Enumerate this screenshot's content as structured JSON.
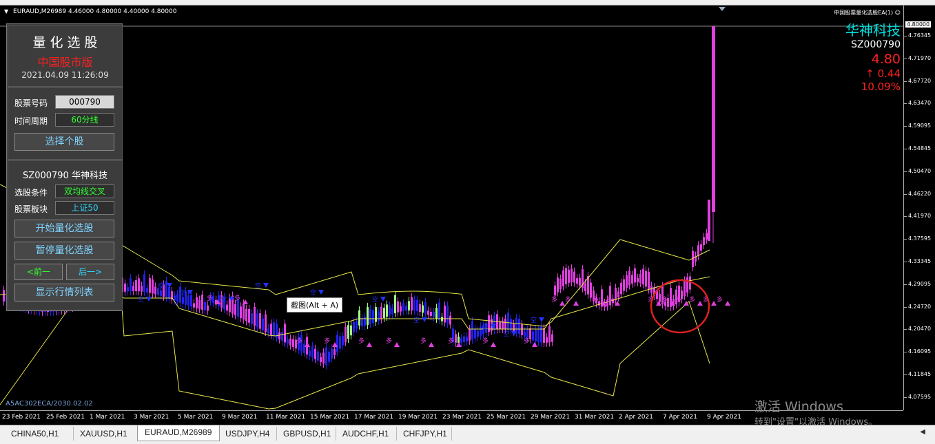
{
  "header": {
    "symbol_info": "EURAUD,M26989  4.46000 4.80000 4.40000 4.80000",
    "ea_name": "中国股票量化选股EA(1)"
  },
  "stock_info": {
    "name": "华神科技",
    "code": "SZ000790",
    "price": "4.80",
    "change": "↑ 0.44",
    "change_pct": "10.09%"
  },
  "panel": {
    "title": "量 化 选 股",
    "subtitle": "中国股市版",
    "datetime": "2021.04.09 11:26:09",
    "stock_code_label": "股票号码",
    "stock_code_value": "000790",
    "period_label": "时间周期",
    "period_value": "60分线",
    "select_stock_button": "选择个股",
    "current_stock": "SZ000790 华神科技",
    "condition_label": "选股条件",
    "condition_value": "双均线交叉",
    "sector_label": "股票板块",
    "sector_value": "上证50",
    "start_button": "开始量化选股",
    "pause_button": "暂停量化选股",
    "prev_button": "<前一",
    "next_button": "后一>",
    "show_list_button": "显示行情列表"
  },
  "tooltip": "截图(Alt + A)",
  "build_label": "A5AC302ECA/2030.02.02",
  "watermark": {
    "line1": "激活 Windows",
    "line2": "转到\"设置\"以激活 Windows。"
  },
  "price_axis": {
    "current": "4.80000",
    "ticks": [
      "4.76345",
      "4.71970",
      "4.67720",
      "4.63470",
      "4.59095",
      "4.54845",
      "4.50470",
      "4.46220",
      "4.41970",
      "4.37595",
      "4.33345",
      "4.29095",
      "4.24720",
      "4.20470",
      "4.16095",
      "4.11845",
      "4.07595"
    ]
  },
  "time_axis": {
    "ticks": [
      "23 Feb 2021",
      "25 Feb 2021",
      "1 Mar 2021",
      "3 Mar 2021",
      "5 Mar 2021",
      "9 Mar 2021",
      "11 Mar 2021",
      "15 Mar 2021",
      "17 Mar 2021",
      "19 Mar 2021",
      "23 Mar 2021",
      "25 Mar 2021",
      "29 Mar 2021",
      "31 Mar 2021",
      "2 Apr 2021",
      "7 Apr 2021",
      "9 Apr 2021"
    ]
  },
  "tabs": [
    "CHINA50,H1",
    "XAUUSD,H1",
    "EURAUD,M26989",
    "USDJPY,H4",
    "GBPUSD,H1",
    "AUDCHF,H1",
    "CHFJPY,H1"
  ],
  "active_tab": "EURAUD,M26989",
  "signal_labels": {
    "buy": "多",
    "sell": "空"
  },
  "colors": {
    "bull_candle": "#e040e0",
    "bear_candle": "#2222ee",
    "green_candle": "#a0ff80",
    "band": "#e6e64a",
    "highlight_circle": "#e02020",
    "stock_name": "#00e0e0",
    "price_up": "#ff2020"
  }
}
